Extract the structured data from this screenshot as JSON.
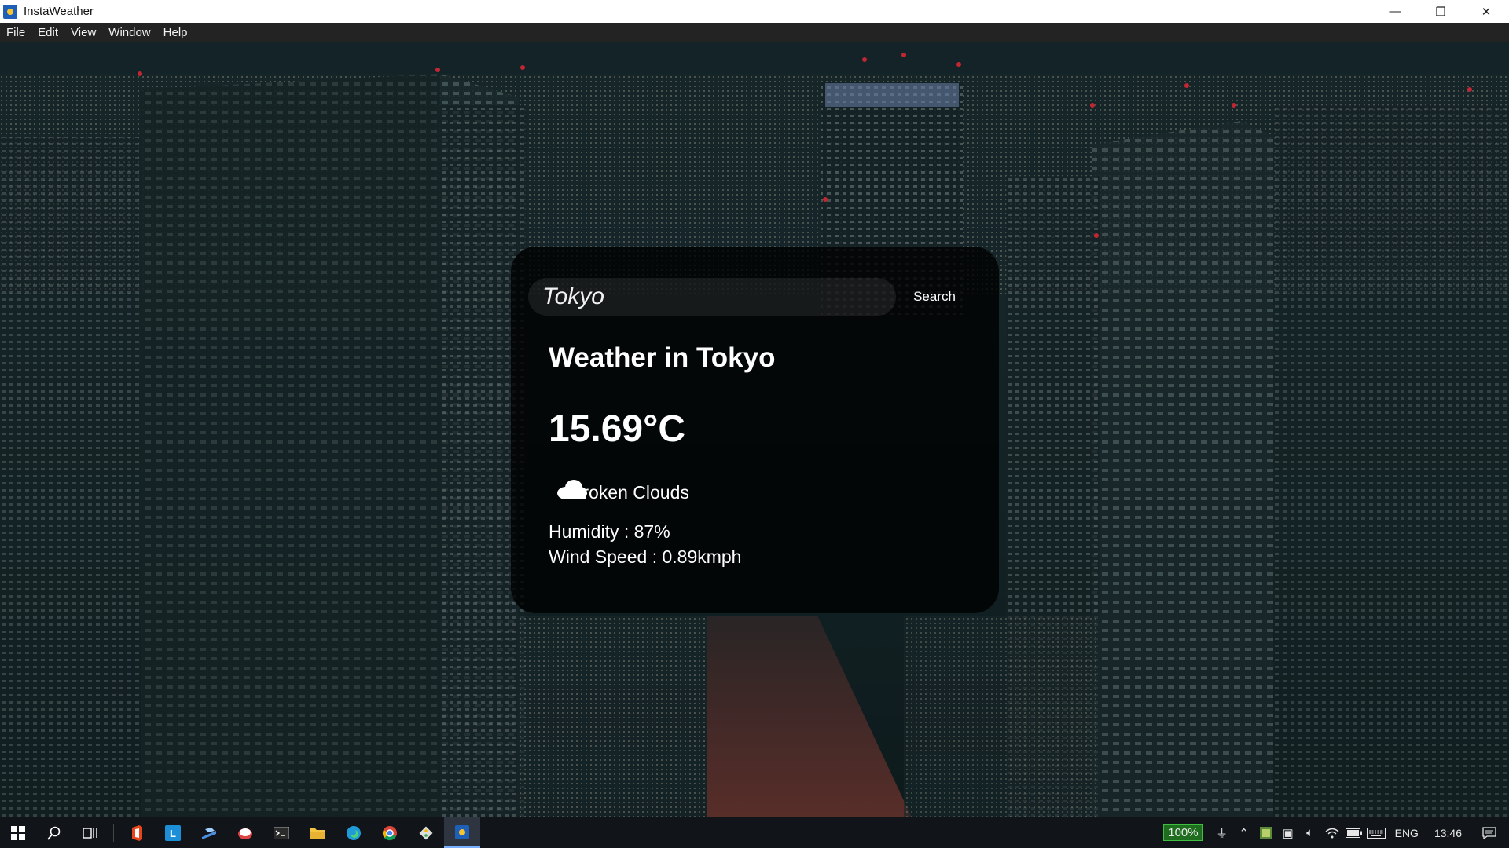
{
  "window": {
    "title": "InstaWeather",
    "minimize_glyph": "—",
    "maximize_glyph": "❐",
    "close_glyph": "✕"
  },
  "menu": [
    "File",
    "Edit",
    "View",
    "Window",
    "Help"
  ],
  "search": {
    "value": "Tokyo",
    "button_label": "Search"
  },
  "weather": {
    "title": "Weather in Tokyo",
    "temperature": "15.69°C",
    "condition": "Broken Clouds",
    "condition_icon": "cloud-icon",
    "humidity": "Humidity : 87%",
    "wind": "Wind Speed : 0.89kmph"
  },
  "taskbar": {
    "apps": [
      "start-icon",
      "search-icon",
      "task-view-icon",
      "office-icon",
      "lync-icon",
      "paint-icon",
      "app-icon",
      "terminal-icon",
      "file-explorer-icon",
      "edge-icon",
      "chrome-icon",
      "git-icon",
      "instaweather-icon"
    ],
    "active_app": "instaweather-icon"
  },
  "tray": {
    "battery": "100%",
    "language": "ENG",
    "time": "13:46"
  }
}
